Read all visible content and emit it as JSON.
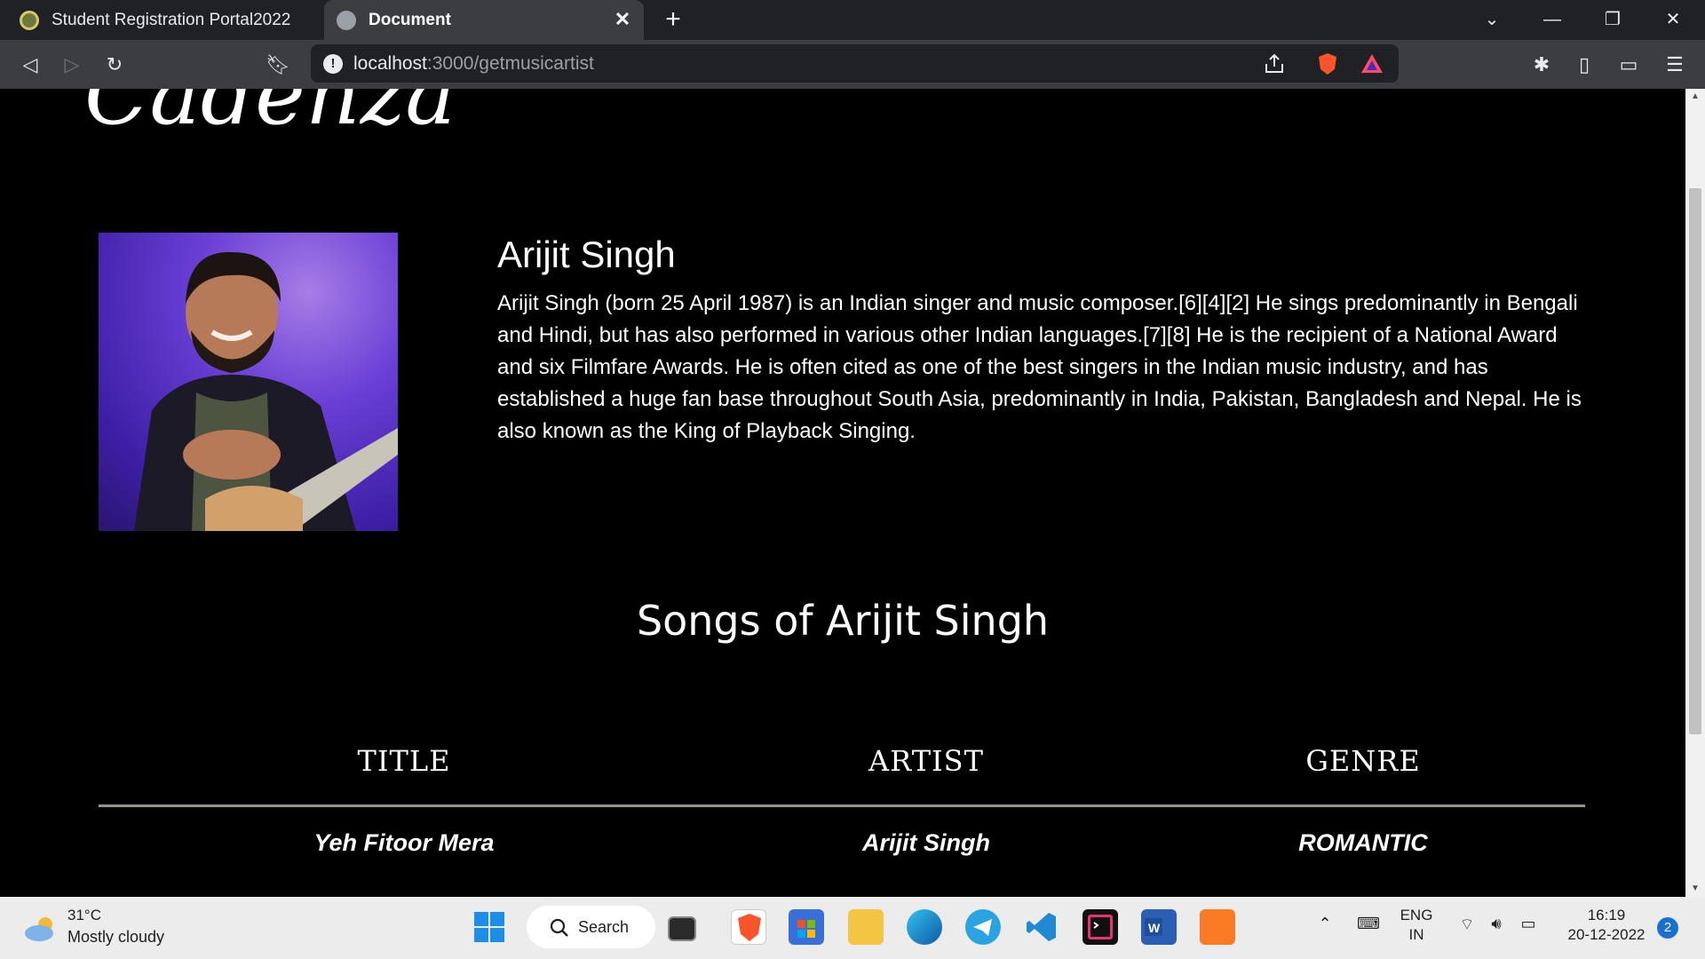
{
  "browser": {
    "tabs": [
      {
        "title": "Student Registration Portal2022",
        "active": false
      },
      {
        "title": "Document",
        "active": true
      }
    ],
    "url_host": "localhost",
    "url_path": ":3000/getmusicartist"
  },
  "page": {
    "logo_text": "Cadenza",
    "artist": {
      "name": "Arijit Singh",
      "bio": "Arijit Singh (born 25 April 1987) is an Indian singer and music composer.[6][4][2] He sings predominantly in Bengali and Hindi, but has also performed in various other Indian languages.[7][8] He is the recipient of a National Award and six Filmfare Awards. He is often cited as one of the best singers in the Indian music industry, and has established a huge fan base throughout South Asia, predominantly in India, Pakistan, Bangladesh and Nepal. He is also known as the King of Playback Singing."
    },
    "songs_heading": "Songs of Arijit Singh",
    "table": {
      "headers": [
        "TITLE",
        "ARTIST",
        "GENRE"
      ],
      "rows": [
        [
          "Yeh Fitoor Mera",
          "Arijit Singh",
          "ROMANTIC"
        ]
      ]
    }
  },
  "taskbar": {
    "weather_temp": "31°C",
    "weather_desc": "Mostly cloudy",
    "search_label": "Search",
    "lang_top": "ENG",
    "lang_bottom": "IN",
    "time": "16:19",
    "date": "20-12-2022",
    "notification_count": "2"
  },
  "colors": {
    "page_bg": "#000000",
    "chrome_bg": "#202124",
    "toolbar_bg": "#3c3d41",
    "table_rule": "#8f9a86"
  }
}
